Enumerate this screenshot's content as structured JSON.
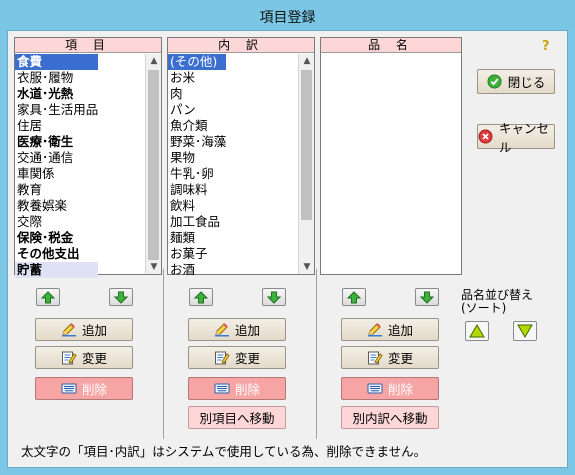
{
  "window": {
    "title": "項目登録"
  },
  "help_label": "?",
  "lists": {
    "items": {
      "header": "項 目",
      "rows": [
        {
          "text": "食費",
          "bold": true,
          "selected": true
        },
        {
          "text": "衣服･履物",
          "bold": false
        },
        {
          "text": "水道･光熱",
          "bold": true
        },
        {
          "text": "家具･生活用品",
          "bold": false
        },
        {
          "text": "住居",
          "bold": false
        },
        {
          "text": "医療･衛生",
          "bold": true
        },
        {
          "text": "交通･通信",
          "bold": false
        },
        {
          "text": "車関係",
          "bold": false
        },
        {
          "text": "教育",
          "bold": false
        },
        {
          "text": "教養娯楽",
          "bold": false
        },
        {
          "text": "交際",
          "bold": false
        },
        {
          "text": "保険･税金",
          "bold": true
        },
        {
          "text": "その他支出",
          "bold": true
        },
        {
          "text": "貯蓄",
          "bold": true,
          "highlight": true
        }
      ]
    },
    "breakdown": {
      "header": "内 訳",
      "rows": [
        {
          "text": "(その他)",
          "selected": true
        },
        {
          "text": "お米"
        },
        {
          "text": "肉"
        },
        {
          "text": "パン"
        },
        {
          "text": "魚介類"
        },
        {
          "text": "野菜･海藻"
        },
        {
          "text": "果物"
        },
        {
          "text": "牛乳･卵"
        },
        {
          "text": "調味料"
        },
        {
          "text": "飲料"
        },
        {
          "text": "加工食品"
        },
        {
          "text": "麺類"
        },
        {
          "text": "お菓子"
        },
        {
          "text": "お酒"
        }
      ]
    },
    "products": {
      "header": "品 名",
      "rows": []
    }
  },
  "buttons": {
    "add": "追加",
    "change": "変更",
    "delete": "削除",
    "move_to_item": "別項目へ移動",
    "move_to_breakdown": "別内訳へ移動",
    "close": "閉じる",
    "cancel": "キャンセル"
  },
  "sort_label": "品名並び替え\n(ソート)",
  "footer_note": "太文字の「項目･内訳」はシステムで使用している為、削除できません。",
  "colors": {
    "titlebar": "#79c6e5",
    "list_header": "#fdd7d7",
    "selection": "#3a6fd1",
    "delete_button": "#f7a4a4",
    "arrow_green": "#3db23d",
    "sort_arrow": "#b4d800"
  }
}
